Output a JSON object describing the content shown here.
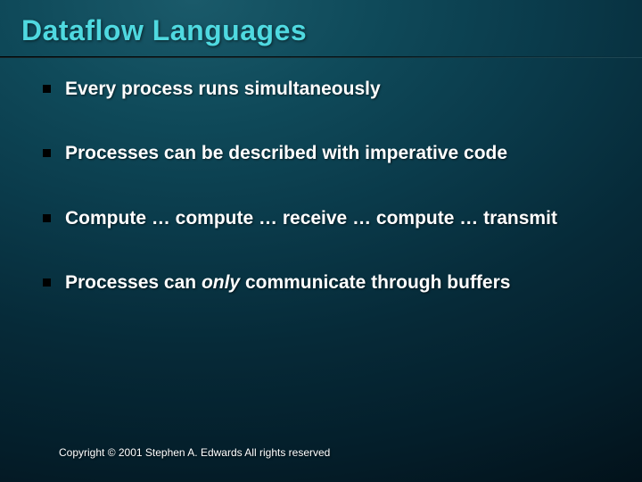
{
  "title": "Dataflow Languages",
  "bullets": [
    {
      "html": "Every process runs simultaneously"
    },
    {
      "html": "Processes can be described with imperative code"
    },
    {
      "html": "Compute … compute … receive … compute … transmit"
    },
    {
      "html": "Processes can <span class=\"em\">only</span> communicate through buffers"
    }
  ],
  "footer": "Copyright © 2001 Stephen A. Edwards  All rights reserved"
}
